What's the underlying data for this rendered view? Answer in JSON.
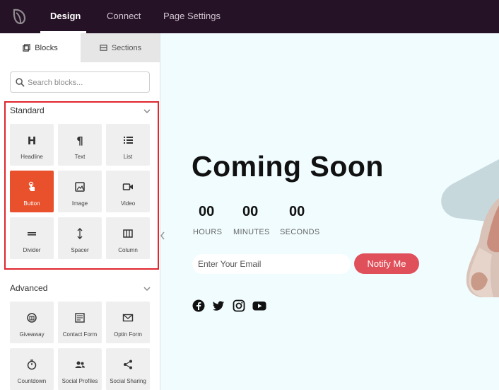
{
  "topbar": {
    "nav": [
      {
        "label": "Design",
        "active": true
      },
      {
        "label": "Connect",
        "active": false
      },
      {
        "label": "Page Settings",
        "active": false
      }
    ]
  },
  "sidebar": {
    "tabs": [
      {
        "label": "Blocks",
        "active": true,
        "icon": "blocks-icon"
      },
      {
        "label": "Sections",
        "active": false,
        "icon": "sections-icon"
      }
    ],
    "search": {
      "placeholder": "Search blocks..."
    },
    "standard": {
      "title": "Standard",
      "blocks": [
        {
          "label": "Headline",
          "icon": "headline-icon"
        },
        {
          "label": "Text",
          "icon": "paragraph-icon"
        },
        {
          "label": "List",
          "icon": "list-icon"
        },
        {
          "label": "Button",
          "icon": "pointer-icon",
          "active": true
        },
        {
          "label": "Image",
          "icon": "image-icon"
        },
        {
          "label": "Video",
          "icon": "video-icon"
        },
        {
          "label": "Divider",
          "icon": "divider-icon"
        },
        {
          "label": "Spacer",
          "icon": "spacer-icon"
        },
        {
          "label": "Column",
          "icon": "column-icon"
        }
      ]
    },
    "advanced": {
      "title": "Advanced",
      "blocks": [
        {
          "label": "Giveaway",
          "icon": "giveaway-icon"
        },
        {
          "label": "Contact Form",
          "icon": "contact-form-icon"
        },
        {
          "label": "Optin Form",
          "icon": "optin-form-icon"
        },
        {
          "label": "Countdown",
          "icon": "countdown-icon"
        },
        {
          "label": "Social Profiles",
          "icon": "social-profiles-icon"
        },
        {
          "label": "Social Sharing",
          "icon": "share-icon"
        }
      ]
    }
  },
  "main": {
    "title": "Coming Soon",
    "countdown": [
      {
        "value": "00",
        "label": "HOURS"
      },
      {
        "value": "00",
        "label": "MINUTES"
      },
      {
        "value": "00",
        "label": "SECONDS"
      }
    ],
    "email_placeholder": "Enter Your Email",
    "notify_label": "Notify Me",
    "social_icons": [
      "facebook-icon",
      "twitter-icon",
      "instagram-icon",
      "youtube-icon"
    ]
  },
  "colors": {
    "topbar": "#261226",
    "accent": "#e8512b",
    "highlight_border": "#e0262e",
    "notify_button": "#e0505a",
    "canvas_bg": "#f0fcfe"
  }
}
